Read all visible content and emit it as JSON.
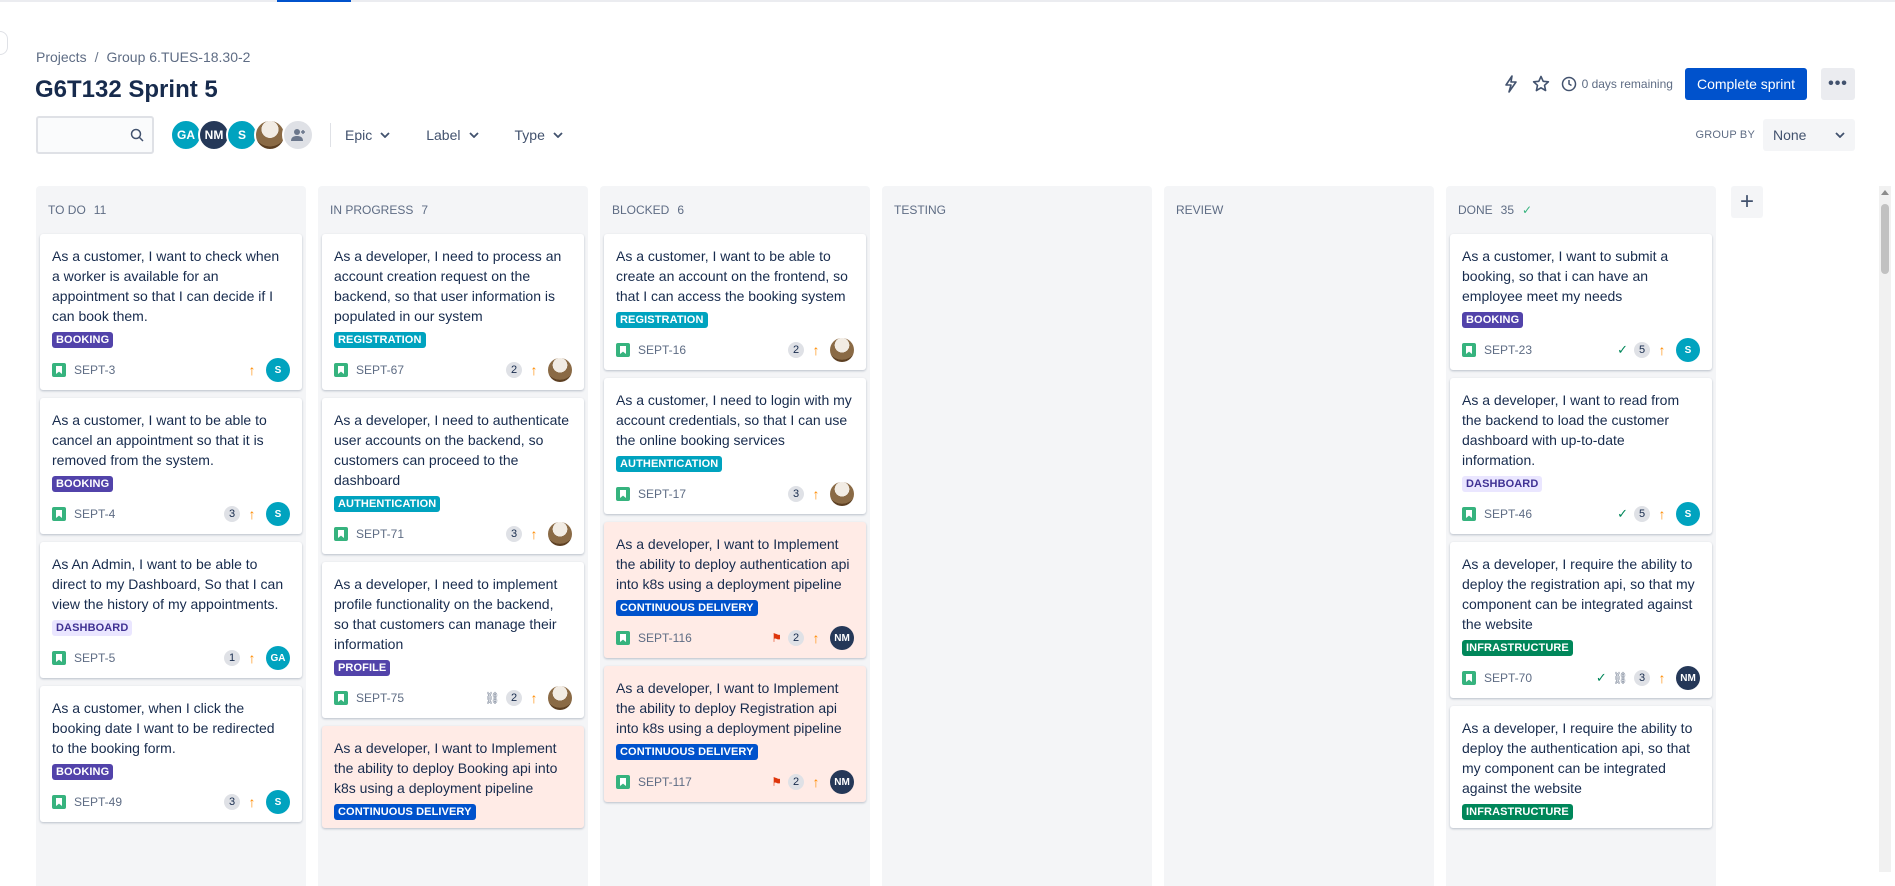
{
  "breadcrumb": {
    "projects": "Projects",
    "separator": "/",
    "group": "Group 6.TUES-18.30-2"
  },
  "page": {
    "title": "G6T132 Sprint 5"
  },
  "header": {
    "days_remaining": "0 days remaining",
    "complete_sprint": "Complete sprint",
    "more": "•••"
  },
  "filters": {
    "search_placeholder": "",
    "avatars": [
      {
        "initials": "GA",
        "color": "#00a3bf"
      },
      {
        "initials": "NM",
        "color": "#253858"
      },
      {
        "initials": "S",
        "color": "#00a3bf"
      }
    ],
    "epic": "Epic",
    "label": "Label",
    "type": "Type",
    "group_by_label": "GROUP BY",
    "group_by_value": "None"
  },
  "columns": [
    {
      "name": "TO DO",
      "count": "11"
    },
    {
      "name": "IN PROGRESS",
      "count": "7"
    },
    {
      "name": "BLOCKED",
      "count": "6"
    },
    {
      "name": "TESTING",
      "count": ""
    },
    {
      "name": "REVIEW",
      "count": ""
    },
    {
      "name": "DONE",
      "count": "35"
    }
  ],
  "cards": {
    "todo": [
      {
        "summary": "As a customer, I want to check when a worker is available for an appointment so that I can decide if I can book them.",
        "label": "BOOKING",
        "key": "SEPT-3",
        "points": "",
        "assignee": "S"
      },
      {
        "summary": "As a customer, I want to be able to cancel an appointment so that it is removed from the system.",
        "label": "BOOKING",
        "key": "SEPT-4",
        "points": "3",
        "assignee": "S"
      },
      {
        "summary": "As An Admin, I want to be able to direct to my Dashboard, So that I can view the history of my appointments.",
        "label": "DASHBOARD",
        "key": "SEPT-5",
        "points": "1",
        "assignee": "GA"
      },
      {
        "summary": "As a customer, when I click the booking date I want to be redirected to the booking form.",
        "label": "BOOKING",
        "key": "SEPT-49",
        "points": "3",
        "assignee": "S"
      }
    ],
    "inprogress": [
      {
        "summary": "As a developer, I need to process an account creation request on the backend, so that user information is populated in our system",
        "label": "REGISTRATION",
        "key": "SEPT-67",
        "points": "2"
      },
      {
        "summary": "As a developer, I need to authenticate user accounts on the backend, so customers can proceed to the dashboard",
        "label": "AUTHENTICATION",
        "key": "SEPT-71",
        "points": "3"
      },
      {
        "summary": "As a developer, I need to implement profile functionality on the backend, so that customers can manage their information",
        "label": "PROFILE",
        "key": "SEPT-75",
        "points": "2"
      },
      {
        "summary": "As a developer, I want to Implement the ability to deploy Booking api into k8s using a deployment pipeline",
        "label": "CONTINUOUS DELIVERY"
      }
    ],
    "blocked": [
      {
        "summary": "As a customer, I want to be able to create an account on the frontend, so that I can access the booking system",
        "label": "REGISTRATION",
        "key": "SEPT-16",
        "points": "2"
      },
      {
        "summary": "As a customer, I need to login with my account credentials, so that I can use the online booking services",
        "label": "AUTHENTICATION",
        "key": "SEPT-17",
        "points": "3"
      },
      {
        "summary": "As a developer, I want to Implement the ability to deploy authentication api into k8s using a deployment pipeline",
        "label": "CONTINUOUS DELIVERY",
        "key": "SEPT-116",
        "points": "2",
        "assignee": "NM"
      },
      {
        "summary": "As a developer, I want to Implement the ability to deploy Registration api into k8s using a deployment pipeline",
        "label": "CONTINUOUS DELIVERY",
        "key": "SEPT-117",
        "points": "2",
        "assignee": "NM"
      }
    ],
    "done": [
      {
        "summary": "As a customer, I want to submit a booking, so that i can have an employee meet my needs",
        "label": "BOOKING",
        "key": "SEPT-23",
        "points": "5",
        "assignee": "S"
      },
      {
        "summary": "As a developer, I want to read from the backend to load the customer dashboard with up-to-date information.",
        "label": "DASHBOARD",
        "key": "SEPT-46",
        "points": "5",
        "assignee": "S"
      },
      {
        "summary": "As a developer, I require the ability to deploy the registration api, so that my component can be integrated against the website",
        "label": "INFRASTRUCTURE",
        "key": "SEPT-70",
        "points": "3",
        "assignee": "NM"
      },
      {
        "summary": "As a developer, I require the ability to deploy the authentication api, so that my component can be integrated against the website",
        "label": "INFRASTRUCTURE"
      }
    ]
  }
}
